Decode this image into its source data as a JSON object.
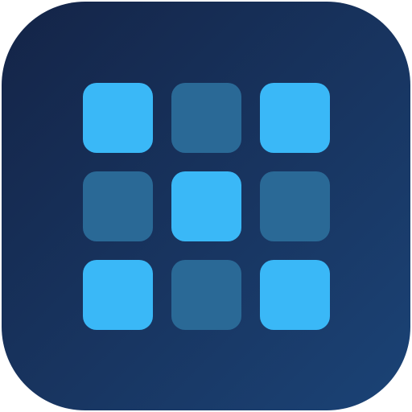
{
  "icon": {
    "name": "grid-app-icon",
    "colors": {
      "background_start": "#142447",
      "background_end": "#1b4376",
      "tile_active": "#3ab8f7",
      "tile_inactive": "#2a6996"
    },
    "grid": {
      "rows": 3,
      "columns": 3,
      "pattern": [
        [
          true,
          false,
          true
        ],
        [
          false,
          true,
          false
        ],
        [
          true,
          false,
          true
        ]
      ]
    }
  }
}
